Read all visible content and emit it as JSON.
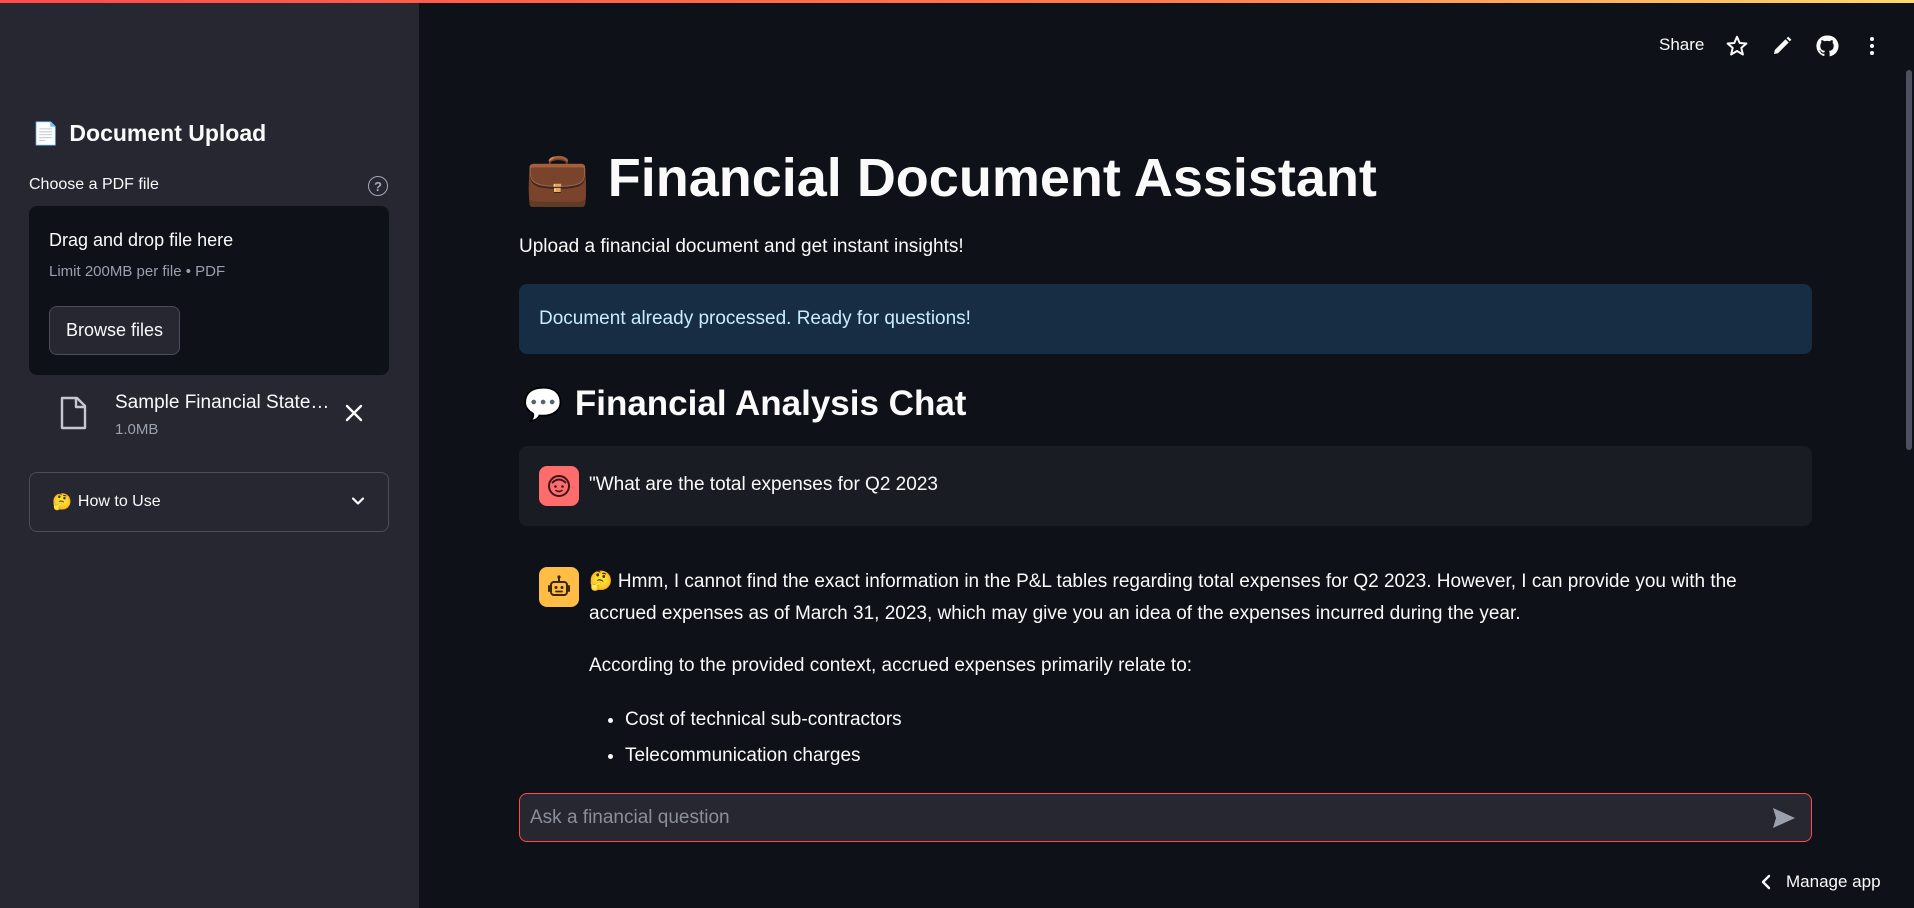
{
  "sidebar": {
    "title_emoji": "📄",
    "title": "Document Upload",
    "uploader_label": "Choose a PDF file",
    "help_glyph": "?",
    "dropzone_title": "Drag and drop file here",
    "dropzone_limit": "Limit 200MB per file • PDF",
    "browse_label": "Browse files",
    "uploaded_file": {
      "name": "Sample Financial Statements.pdf",
      "size": "1.0MB"
    },
    "expander_emoji": "🤔",
    "expander_label": "How to Use"
  },
  "header": {
    "share_label": "Share",
    "icons": [
      "star-icon",
      "edit-icon",
      "github-icon",
      "more-icon"
    ]
  },
  "main": {
    "title_emoji": "💼",
    "title": "Financial Document Assistant",
    "subtitle": "Upload a financial document and get instant insights!",
    "info_message": "Document already processed. Ready for questions!",
    "chat_title_emoji": "💬",
    "chat_title": "Financial Analysis Chat",
    "user_message": "\"What are the total expenses for Q2 2023",
    "assistant": {
      "paragraph1": "🤔 Hmm, I cannot find the exact information in the P&L tables regarding total expenses for Q2 2023. However, I can provide you with the accrued expenses as of March 31, 2023, which may give you an idea of the expenses incurred during the year.",
      "paragraph2": "According to the provided context, accrued expenses primarily relate to:",
      "bullets": [
        "Cost of technical sub-contractors",
        "Telecommunication charges"
      ]
    },
    "chat_input_placeholder": "Ask a financial question"
  },
  "footer": {
    "manage_app_label": "Manage app"
  },
  "colors": {
    "background": "#0e1117",
    "sidebar": "#262730",
    "accent": "#ff4b4b",
    "info_bg": "#172d43",
    "info_text": "#c7ebff",
    "user_avatar": "#ff6c6c",
    "assistant_avatar": "#ffbd45"
  }
}
